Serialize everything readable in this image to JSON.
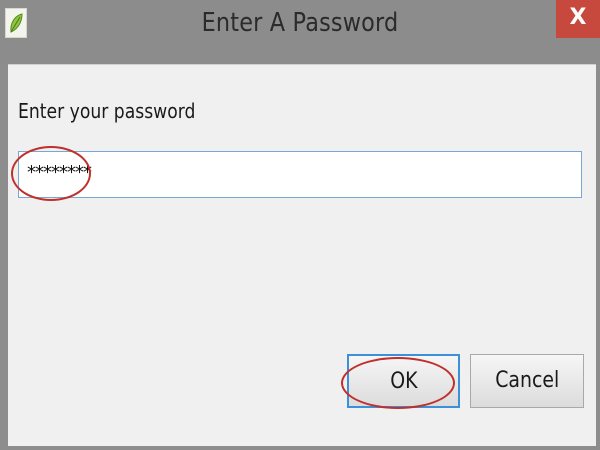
{
  "window": {
    "title": "Enter A Password",
    "icon": "leaf-app-icon",
    "close_label": "X"
  },
  "dialog": {
    "prompt": "Enter your password",
    "password_value": "********"
  },
  "buttons": {
    "ok_label": "OK",
    "cancel_label": "Cancel"
  },
  "colors": {
    "close_button": "#c7483c",
    "annotation_circle": "#c0302a",
    "focus_border": "#3c8fd9"
  }
}
